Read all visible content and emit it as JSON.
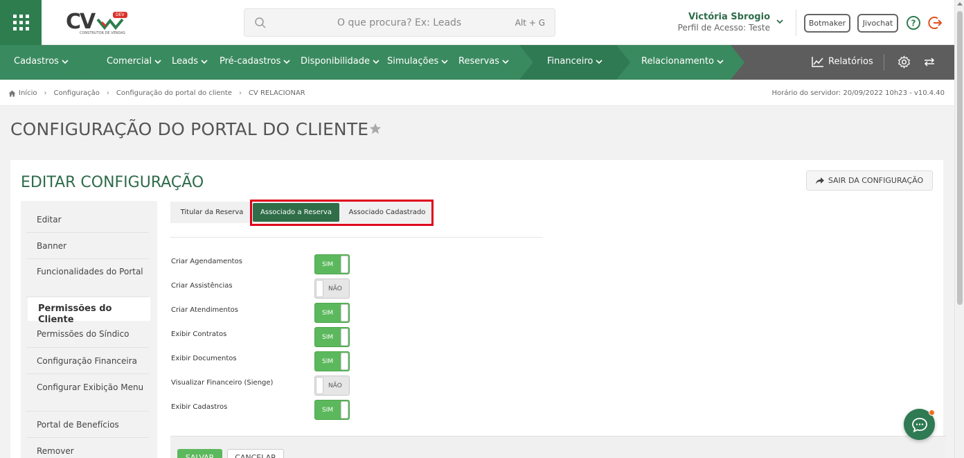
{
  "header": {
    "logo_text": "CV",
    "logo_badge": "DEV",
    "logo_subtitle": "CONSTRUTOR DE VENDAS",
    "search_placeholder": "O que procura? Ex: Leads",
    "search_shortcut": "Alt + G",
    "user_name": "Victória Sbrogio",
    "user_profile": "Perfil de Acesso: Teste",
    "botmaker_label": "Botmaker",
    "jivochat_label": "Jivochat"
  },
  "nav": {
    "items": [
      {
        "label": "Cadastros"
      },
      {
        "label": "Comercial"
      },
      {
        "label": "Leads"
      },
      {
        "label": "Pré-cadastros"
      },
      {
        "label": "Disponibilidade"
      },
      {
        "label": "Simulações"
      },
      {
        "label": "Reservas"
      },
      {
        "label": "Financeiro"
      },
      {
        "label": "Relacionamento"
      }
    ],
    "reports_label": "Relatórios"
  },
  "breadcrumb": {
    "items": [
      "Início",
      "Configuração",
      "Configuração do portal do cliente",
      "CV RELACIONAR"
    ],
    "server_time": "Horário do servidor: 20/09/2022 10h23 - v10.4.40"
  },
  "page": {
    "title": "CONFIGURAÇÃO DO PORTAL DO CLIENTE",
    "card_title": "EDITAR CONFIGURAÇÃO",
    "exit_config_label": "SAIR DA CONFIGURAÇÃO"
  },
  "sidebar": {
    "items": [
      {
        "label": "Editar"
      },
      {
        "label": "Banner"
      },
      {
        "label": "Funcionalidades do Portal"
      },
      {
        "label": "Permissões do Cliente"
      },
      {
        "label": "Permissões do Síndico"
      },
      {
        "label": "Configuração Financeira"
      },
      {
        "label": "Configurar Exibição Menu"
      },
      {
        "label": "Portal de Benefícios"
      },
      {
        "label": "Remover"
      }
    ],
    "active_index": 3
  },
  "tabs": {
    "items": [
      {
        "label": "Titular da Reserva"
      },
      {
        "label": "Associado a Reserva"
      },
      {
        "label": "Associado Cadastrado"
      }
    ],
    "active_index": 1
  },
  "permissions": [
    {
      "label": "Criar Agendamentos",
      "value": "SIM",
      "on": true
    },
    {
      "label": "Criar Assistências",
      "value": "NÃO",
      "on": false
    },
    {
      "label": "Criar Atendimentos",
      "value": "SIM",
      "on": true
    },
    {
      "label": "Exibir Contratos",
      "value": "SIM",
      "on": true
    },
    {
      "label": "Exibir Documentos",
      "value": "SIM",
      "on": true
    },
    {
      "label": "Visualizar Financeiro (Sienge)",
      "value": "NÃO",
      "on": false
    },
    {
      "label": "Exibir Cadastros",
      "value": "SIM",
      "on": true
    }
  ],
  "footer": {
    "save_label": "SALVAR",
    "cancel_label": "CANCELAR"
  },
  "colors": {
    "brand_green": "#2e7d4f",
    "nav_green": "#3a8a5f",
    "toggle_on": "#5cb85c",
    "highlight_red": "#e0001b"
  }
}
